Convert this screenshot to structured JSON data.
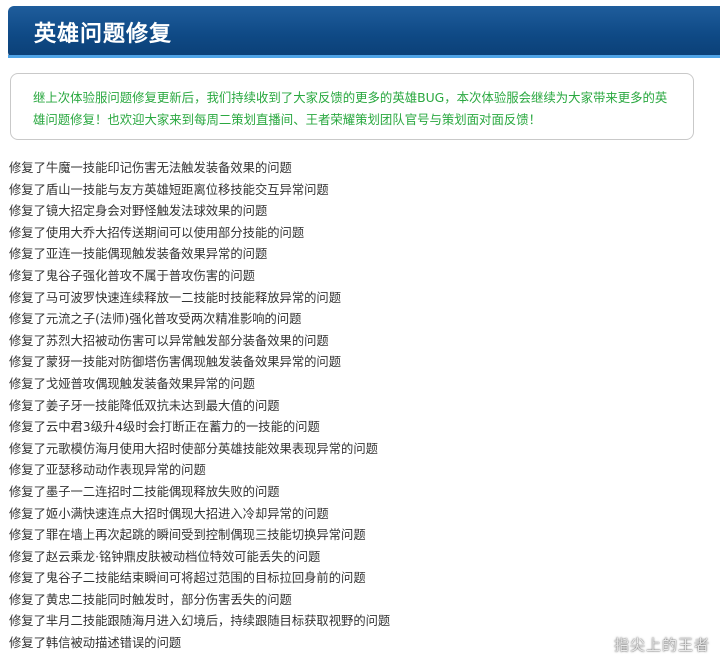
{
  "header": {
    "title": "英雄问题修复"
  },
  "notice": {
    "text": "继上次体验服问题修复更新后，我们持续收到了大家反馈的更多的英雄BUG，本次体验服会继续为大家带来更多的英雄问题修复！也欢迎大家来到每周二策划直播间、王者荣耀策划团队官号与策划面对面反馈！"
  },
  "fixes": [
    "修复了牛魔一技能印记伤害无法触发装备效果的问题",
    "修复了盾山一技能与友方英雄短距离位移技能交互异常问题",
    "修复了镜大招定身会对野怪触发法球效果的问题",
    "修复了使用大乔大招传送期间可以使用部分技能的问题",
    "修复了亚连一技能偶现触发装备效果异常的问题",
    "修复了鬼谷子强化普攻不属于普攻伤害的问题",
    "修复了马可波罗快速连续释放一二技能时技能释放异常的问题",
    "修复了元流之子(法师)强化普攻受两次精准影响的问题",
    "修复了苏烈大招被动伤害可以异常触发部分装备效果的问题",
    "修复了蒙犽一技能对防御塔伤害偶现触发装备效果异常的问题",
    "修复了戈娅普攻偶现触发装备效果异常的问题",
    "修复了姜子牙一技能降低双抗未达到最大值的问题",
    "修复了云中君3级升4级时会打断正在蓄力的一技能的问题",
    "修复了元歌模仿海月使用大招时使部分英雄技能效果表现异常的问题",
    "修复了亚瑟移动动作表现异常的问题",
    "修复了墨子一二连招时二技能偶现释放失败的问题",
    "修复了姬小满快速连点大招时偶现大招进入冷却异常的问题",
    "修复了罪在墙上再次起跳的瞬间受到控制偶现三技能切换异常问题",
    "修复了赵云乘龙·铭钟鼎皮肤被动档位特效可能丢失的问题",
    "修复了鬼谷子二技能结束瞬间可将超过范围的目标拉回身前的问题",
    "修复了黄忠二技能同时触发时，部分伤害丢失的问题",
    "修复了芈月二技能跟随海月进入幻境后，持续跟随目标获取视野的问题",
    "修复了韩信被动描述错误的问题"
  ],
  "watermark": "指尖上的王者"
}
